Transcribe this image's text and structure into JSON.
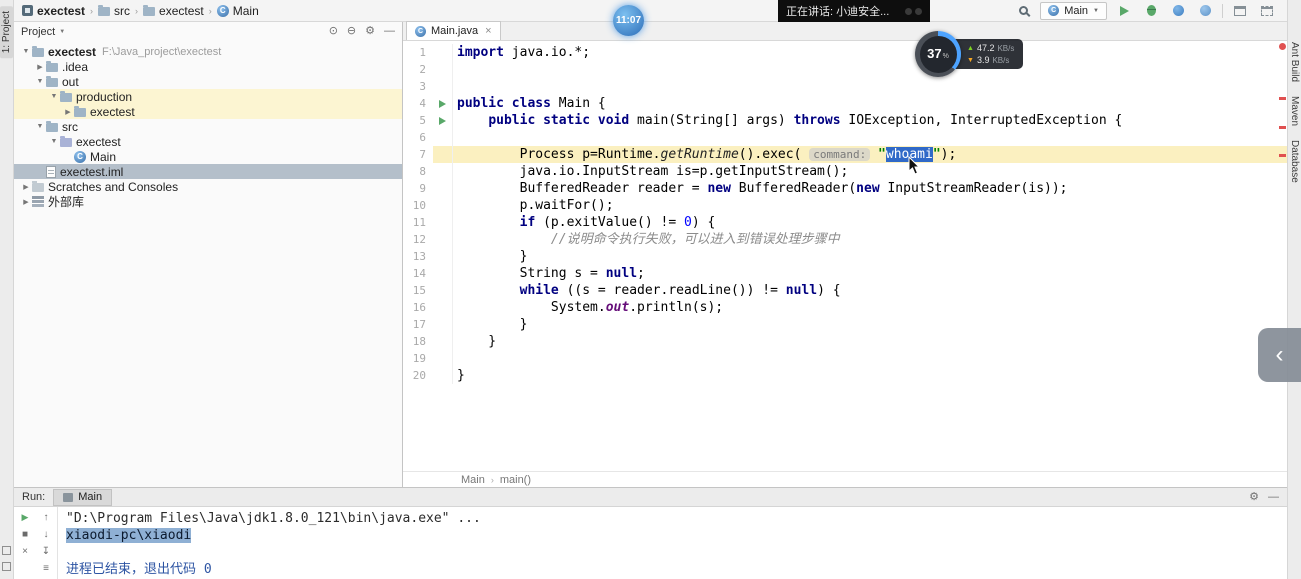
{
  "navbar": {
    "breadcrumbs": [
      {
        "label": "exectest",
        "icon": "project",
        "bold": true
      },
      {
        "label": "src",
        "icon": "folder"
      },
      {
        "label": "exectest",
        "icon": "folder"
      },
      {
        "label": "Main",
        "icon": "class"
      }
    ],
    "run_config_label": "Main"
  },
  "overlays": {
    "clock_time": "11:07",
    "speaking_text": "正在讲话: 小迪安全...",
    "gauge_value": "37",
    "gauge_unit": "%",
    "net_up_value": "47.2",
    "net_up_unit": "KB/s",
    "net_down_value": "3.9",
    "net_down_unit": "KB/s"
  },
  "project_panel": {
    "title": "Project",
    "tree": [
      {
        "label": "exectest",
        "suffix": "F:\\Java_project\\exectest",
        "level": 0,
        "chevron": "v",
        "icon": "folder",
        "bold": true
      },
      {
        "label": ".idea",
        "level": 1,
        "chevron": ">",
        "icon": "folder"
      },
      {
        "label": "out",
        "level": 1,
        "chevron": "v",
        "icon": "folder"
      },
      {
        "label": "production",
        "level": 2,
        "chevron": "v",
        "icon": "folder",
        "highlight": true
      },
      {
        "label": "exectest",
        "level": 3,
        "chevron": ">",
        "icon": "folder",
        "highlight": true
      },
      {
        "label": "src",
        "level": 1,
        "chevron": "v",
        "icon": "folder"
      },
      {
        "label": "exectest",
        "level": 2,
        "chevron": "v",
        "icon": "package"
      },
      {
        "label": "Main",
        "level": 3,
        "chevron": "",
        "icon": "class"
      },
      {
        "label": "exectest.iml",
        "level": 1,
        "chevron": "",
        "icon": "file",
        "selected": true
      },
      {
        "label": "Scratches and Consoles",
        "level": 0,
        "chevron": ">",
        "icon": "scratch"
      },
      {
        "label": "外部库",
        "level": 0,
        "chevron": ">",
        "icon": "library"
      }
    ]
  },
  "editor": {
    "tab_label": "Main.java",
    "breadcrumbs": [
      "Main",
      "main()"
    ],
    "lines": [
      {
        "num": 1,
        "tokens": [
          {
            "t": "import",
            "c": "kw"
          },
          {
            "t": " java.io.*;",
            "c": "pl"
          }
        ]
      },
      {
        "num": 2,
        "tokens": []
      },
      {
        "num": 3,
        "tokens": []
      },
      {
        "num": 4,
        "run": true,
        "tokens": [
          {
            "t": "public class ",
            "c": "kw"
          },
          {
            "t": "Main",
            "c": "cls"
          },
          {
            "t": " {",
            "c": "pl"
          }
        ]
      },
      {
        "num": 5,
        "run": true,
        "tokens": [
          {
            "t": "    ",
            "c": "pl"
          },
          {
            "t": "public static void ",
            "c": "kw"
          },
          {
            "t": "main(String[] args) ",
            "c": "pl"
          },
          {
            "t": "throws ",
            "c": "kw"
          },
          {
            "t": "IOException, InterruptedException {",
            "c": "pl"
          }
        ]
      },
      {
        "num": 6,
        "tokens": []
      },
      {
        "num": 7,
        "current": true,
        "tokens": [
          {
            "t": "        Process p=Runtime.",
            "c": "pl"
          },
          {
            "t": "getRuntime",
            "c": "it"
          },
          {
            "t": "().exec( ",
            "c": "pl"
          },
          {
            "t": "command:",
            "c": "hint"
          },
          {
            "t": " ",
            "c": "pl"
          },
          {
            "t": "\"",
            "c": "str"
          },
          {
            "t": "whoami",
            "c": "sel"
          },
          {
            "t": "\"",
            "c": "str"
          },
          {
            "t": ");",
            "c": "pl"
          }
        ]
      },
      {
        "num": 8,
        "tokens": [
          {
            "t": "        java.io.InputStream is=p.getInputStream();",
            "c": "pl"
          }
        ]
      },
      {
        "num": 9,
        "tokens": [
          {
            "t": "        BufferedReader reader = ",
            "c": "pl"
          },
          {
            "t": "new ",
            "c": "kw"
          },
          {
            "t": "BufferedReader(",
            "c": "pl"
          },
          {
            "t": "new ",
            "c": "kw"
          },
          {
            "t": "InputStreamReader(is));",
            "c": "pl"
          }
        ]
      },
      {
        "num": 10,
        "tokens": [
          {
            "t": "        p.waitFor();",
            "c": "pl"
          }
        ]
      },
      {
        "num": 11,
        "tokens": [
          {
            "t": "        ",
            "c": "pl"
          },
          {
            "t": "if ",
            "c": "kw"
          },
          {
            "t": "(p.exitValue() != ",
            "c": "pl"
          },
          {
            "t": "0",
            "c": "num"
          },
          {
            "t": ") {",
            "c": "pl"
          }
        ]
      },
      {
        "num": 12,
        "tokens": [
          {
            "t": "            //说明命令执行失败，可以进入到错误处理步骤中",
            "c": "cmt"
          }
        ]
      },
      {
        "num": 13,
        "tokens": [
          {
            "t": "        }",
            "c": "pl"
          }
        ]
      },
      {
        "num": 14,
        "tokens": [
          {
            "t": "        String s = ",
            "c": "pl"
          },
          {
            "t": "null",
            "c": "kw"
          },
          {
            "t": ";",
            "c": "pl"
          }
        ]
      },
      {
        "num": 15,
        "tokens": [
          {
            "t": "        ",
            "c": "pl"
          },
          {
            "t": "while ",
            "c": "kw"
          },
          {
            "t": "((s = reader.readLine()) != ",
            "c": "pl"
          },
          {
            "t": "null",
            "c": "kw"
          },
          {
            "t": ") {",
            "c": "pl"
          }
        ]
      },
      {
        "num": 16,
        "tokens": [
          {
            "t": "            System.",
            "c": "pl"
          },
          {
            "t": "out",
            "c": "fld"
          },
          {
            "t": ".println(s);",
            "c": "pl"
          }
        ]
      },
      {
        "num": 17,
        "tokens": [
          {
            "t": "        }",
            "c": "pl"
          }
        ]
      },
      {
        "num": 18,
        "tokens": [
          {
            "t": "    }",
            "c": "pl"
          }
        ]
      },
      {
        "num": 19,
        "tokens": []
      },
      {
        "num": 20,
        "tokens": [
          {
            "t": "}",
            "c": "pl"
          }
        ]
      }
    ]
  },
  "run_panel": {
    "label": "Run:",
    "tab_label": "Main",
    "lines": [
      {
        "tokens": [
          {
            "t": "\"D:\\Program Files\\Java\\jdk1.8.0_121\\bin\\java.exe\" ...",
            "c": "out"
          }
        ]
      },
      {
        "tokens": [
          {
            "t": "xiaodi-pc\\xiaodi",
            "c": "sel"
          }
        ]
      },
      {
        "tokens": []
      },
      {
        "tokens": [
          {
            "t": "进程已结束，退出代码 0",
            "c": "sys"
          }
        ]
      }
    ]
  },
  "right_stripe": {
    "buttons": [
      "Ant Build",
      "Maven",
      "Database"
    ]
  },
  "left_stripe": {
    "project_button": "1: Project"
  },
  "colors": {
    "keyword": "#000080",
    "string": "#008000",
    "comment": "#8c8c8c",
    "run_green": "#59a869",
    "editor_selection": "#3069c8",
    "current_line": "#fbf0c0",
    "tree_selection": "#b4bfca",
    "error_red": "#e05050"
  }
}
